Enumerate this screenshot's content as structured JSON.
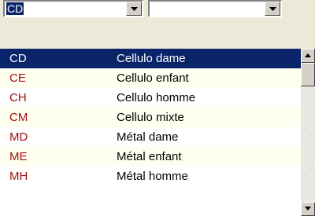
{
  "filters": {
    "code_combo_value": "CD",
    "second_combo_value": ""
  },
  "list": {
    "rows": [
      {
        "code": "CD",
        "label": "Cellulo dame",
        "selected": true
      },
      {
        "code": "CE",
        "label": "Cellulo enfant"
      },
      {
        "code": "CH",
        "label": "Cellulo homme"
      },
      {
        "code": "CM",
        "label": "Cellulo mixte"
      },
      {
        "code": "MD",
        "label": "Métal dame"
      },
      {
        "code": "ME",
        "label": "Métal enfant"
      },
      {
        "code": "MH",
        "label": "Métal homme"
      }
    ]
  },
  "icons": {
    "dropdown": "chevron-down-icon",
    "scroll_up": "arrow-up-icon",
    "scroll_down": "arrow-down-icon"
  },
  "colors": {
    "selection": "#0a246a",
    "code_text": "#a01010",
    "alt_row": "#fffff0"
  }
}
